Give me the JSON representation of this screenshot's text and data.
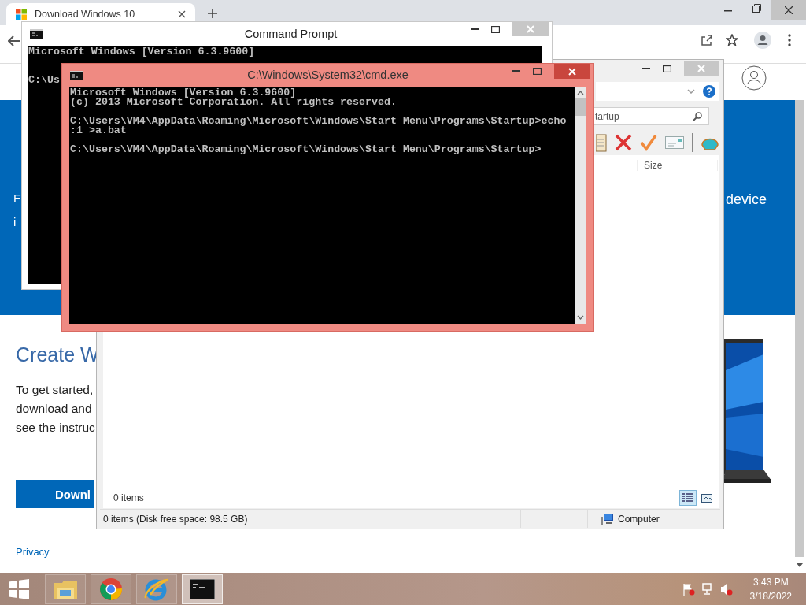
{
  "browser": {
    "tab": {
      "title": "Download Windows 10"
    },
    "page": {
      "banner_lines": [
        "E",
        "i"
      ],
      "banner_right": "device",
      "heading": "Create W",
      "paragraph_lines": [
        "To get started,",
        "download and",
        "see the instruc"
      ],
      "download_button": "Downl",
      "privacy_link": "Privacy"
    }
  },
  "explorer": {
    "search": {
      "value": "tartup"
    },
    "column_header": "Size",
    "item_count": "0 items",
    "views": [
      {
        "kind": "details",
        "selected": true
      },
      {
        "kind": "tiles",
        "selected": false
      }
    ],
    "status_bar": {
      "left": "0 items (Disk free space: 98.5 GB)",
      "right": "Computer"
    }
  },
  "command_prompt": {
    "title": "Command Prompt",
    "paragraphs": [
      [
        "Microsoft Windows [Version 6.3.9600]"
      ],
      [
        "C:\\Us"
      ]
    ]
  },
  "cmd_window": {
    "title": "C:\\Windows\\System32\\cmd.exe",
    "paragraphs": [
      [
        "Microsoft Windows [Version 6.3.9600]",
        "(c) 2013 Microsoft Corporation. All rights reserved."
      ],
      [
        "C:\\Users\\VM4\\AppData\\Roaming\\Microsoft\\Windows\\Start Menu\\Programs\\Startup>echo",
        ":1 >a.bat"
      ],
      [
        "C:\\Users\\VM4\\AppData\\Roaming\\Microsoft\\Windows\\Start Menu\\Programs\\Startup>"
      ]
    ]
  },
  "taskbar": {
    "apps": [
      {
        "kind": "folder",
        "selected": false
      },
      {
        "kind": "chrome",
        "selected": false
      },
      {
        "kind": "ie",
        "selected": false
      },
      {
        "kind": "console",
        "selected": true
      }
    ],
    "time": "3:43 PM",
    "date": "3/18/2022"
  }
}
